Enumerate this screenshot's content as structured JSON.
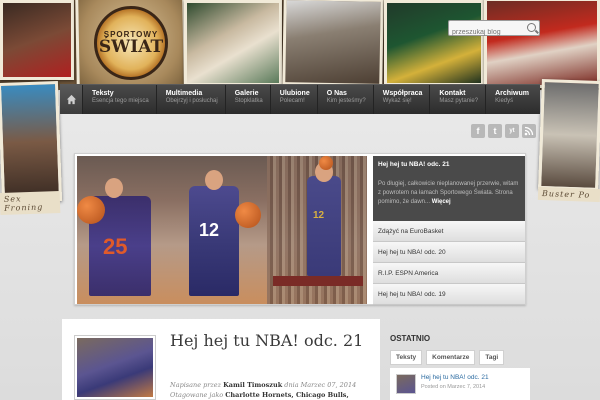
{
  "site": {
    "logo_top": "SPORTOWY",
    "logo_bottom": "ŚWIAT"
  },
  "search": {
    "placeholder": "przeszukaj blog"
  },
  "collage": {
    "left_caption": "Sex Froning",
    "right_caption": "Buster Po"
  },
  "nav": {
    "items": [
      {
        "title": "Teksty",
        "sub": "Esencja tego miejsca"
      },
      {
        "title": "Multimedia",
        "sub": "Obejrzyj i posłuchaj"
      },
      {
        "title": "Galerie",
        "sub": "Stopklatka"
      },
      {
        "title": "Ulubione",
        "sub": "Polecam!"
      },
      {
        "title": "O Nas",
        "sub": "Kim jesteśmy?"
      },
      {
        "title": "Współpraca",
        "sub": "Wykaż się!"
      },
      {
        "title": "Kontakt",
        "sub": "Masz pytanie?"
      },
      {
        "title": "Archiwum",
        "sub": "Kiedyś"
      }
    ]
  },
  "social": [
    "f",
    "t",
    "yt",
    "rss"
  ],
  "featured": {
    "image_numbers": [
      "25",
      "12",
      "12"
    ],
    "active": {
      "title": "Hej hej tu NBA! odc. 21",
      "desc": "Po długiej, całkowicie nieplanowanej przerwie, witam z powrotem na łamach Sportowego Świata. Strona pomimo, że dawn...",
      "more": "Więcej"
    },
    "list": [
      "Zdążyć na EuroBasket",
      "Hej hej tu NBA! odc. 20",
      "R.I.P. ESPN America",
      "Hej hej tu NBA! odc. 19"
    ]
  },
  "post": {
    "title": "Hej hej tu NBA! odc. 21",
    "meta_line1_prefix": "Napisane przez",
    "author": "Kamil Timoszuk",
    "meta_line1_suffix": "dnia Marzec 07, 2014",
    "meta_line2_prefix": "Otagowane jako",
    "tags": "Charlotte Hornets, Chicago Bulls,"
  },
  "sidebar": {
    "heading": "OSTATNIO",
    "tabs": [
      "Teksty",
      "Komentarze",
      "Tagi"
    ],
    "item_title": "Hej hej tu NBA! odc. 21",
    "item_date": "Posted on Marzec 7, 2014"
  }
}
